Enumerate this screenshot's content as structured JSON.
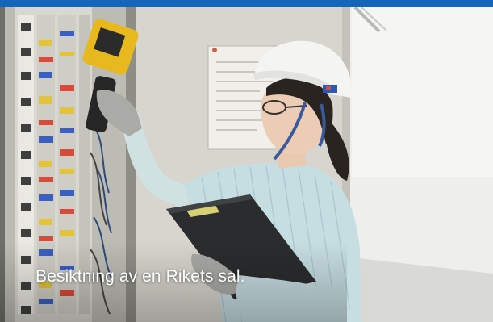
{
  "banner": {
    "accent_color": "#1565b8"
  },
  "photo": {
    "subject": "technician-with-thermal-camera"
  },
  "caption": {
    "text": "Besiktning av en Rikets sal."
  }
}
